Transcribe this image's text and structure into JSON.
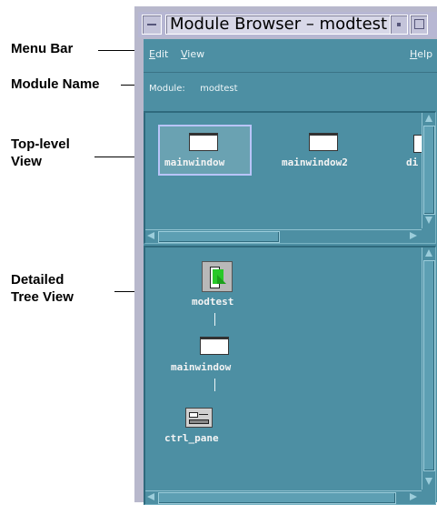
{
  "callouts": {
    "menu_bar": "Menu Bar",
    "module_name": "Module Name",
    "top_level_view": "Top-level\nView",
    "detailed_tree_view": "Detailed\nTree View"
  },
  "window": {
    "title": "Module Browser – modtest"
  },
  "menubar": {
    "edit": "Edit",
    "view": "View",
    "help": "Help"
  },
  "module": {
    "label": "Module:",
    "name": "modtest"
  },
  "top_level": {
    "items": [
      {
        "label": "mainwindow",
        "selected": true
      },
      {
        "label": "mainwindow2",
        "selected": false
      },
      {
        "label": "di",
        "selected": false
      }
    ]
  },
  "tree": {
    "nodes": [
      {
        "label": "modtest",
        "icon": "module-icon"
      },
      {
        "label": "mainwindow",
        "icon": "window-icon"
      },
      {
        "label": "ctrl_pane",
        "icon": "control-pane-icon"
      }
    ]
  }
}
